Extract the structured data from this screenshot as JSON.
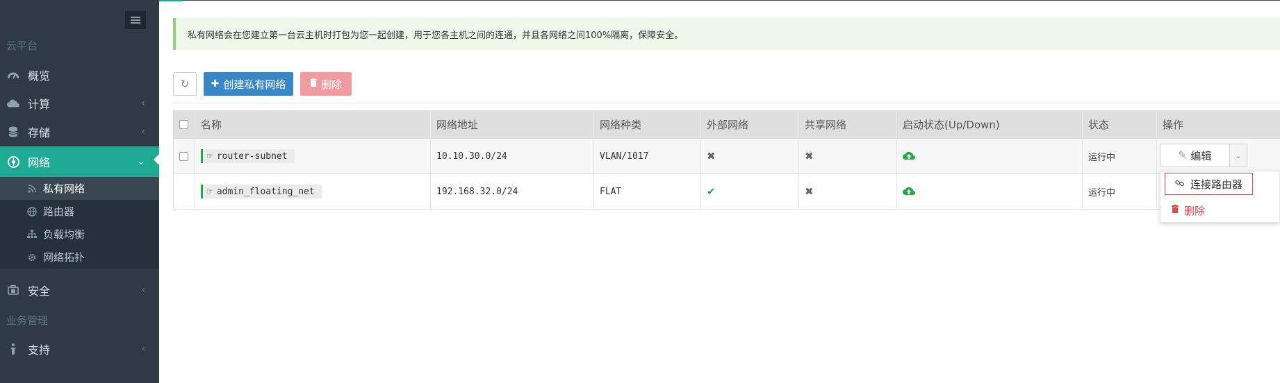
{
  "sidebar": {
    "section_cloud": "云平台",
    "section_business": "业务管理",
    "items": [
      {
        "label": "概览",
        "icon": "dashboard-icon"
      },
      {
        "label": "计算",
        "icon": "cloud-icon"
      },
      {
        "label": "存储",
        "icon": "database-icon"
      },
      {
        "label": "网络",
        "icon": "network-icon",
        "active": true
      },
      {
        "label": "安全",
        "icon": "shield-icon"
      },
      {
        "label": "支持",
        "icon": "support-icon"
      }
    ],
    "network_sub": [
      {
        "label": "私有网络",
        "icon": "rss-icon",
        "current": true
      },
      {
        "label": "路由器",
        "icon": "globe-icon"
      },
      {
        "label": "负载均衡",
        "icon": "sitemap-icon"
      },
      {
        "label": "网络拓扑",
        "icon": "gear-icon"
      }
    ]
  },
  "alert": {
    "text": "私有网络会在您建立第一台云主机时打包为您一起创建，用于您各主机之间的连通，并且各网络之间100%隔离，保障安全。"
  },
  "toolbar": {
    "refresh_label": "",
    "create_label": "创建私有网络",
    "delete_label": "删除"
  },
  "table": {
    "headers": [
      "名称",
      "网络地址",
      "网络种类",
      "外部网络",
      "共享网络",
      "启动状态(Up/Down)",
      "状态",
      "操作"
    ],
    "rows": [
      {
        "name": "router-subnet",
        "address": "10.10.30.0/24",
        "type": "VLAN/1017",
        "external": false,
        "shared": false,
        "admin_state": "up",
        "status": "运行中"
      },
      {
        "name": "admin_floating_net",
        "address": "192.168.32.0/24",
        "type": "FLAT",
        "external": true,
        "shared": false,
        "admin_state": "up",
        "status": "运行中"
      }
    ]
  },
  "actions": {
    "edit_label": "编辑",
    "menu": {
      "connect_router_label": "连接路由器",
      "delete_label": "删除"
    }
  },
  "colors": {
    "sidebar_bg": "#2f3a45",
    "active_teal": "#1eaa94",
    "primary_blue": "#3a87c8",
    "danger_pink": "#f19aa0",
    "success_green": "#27a844",
    "danger_red": "#e04b4b"
  }
}
